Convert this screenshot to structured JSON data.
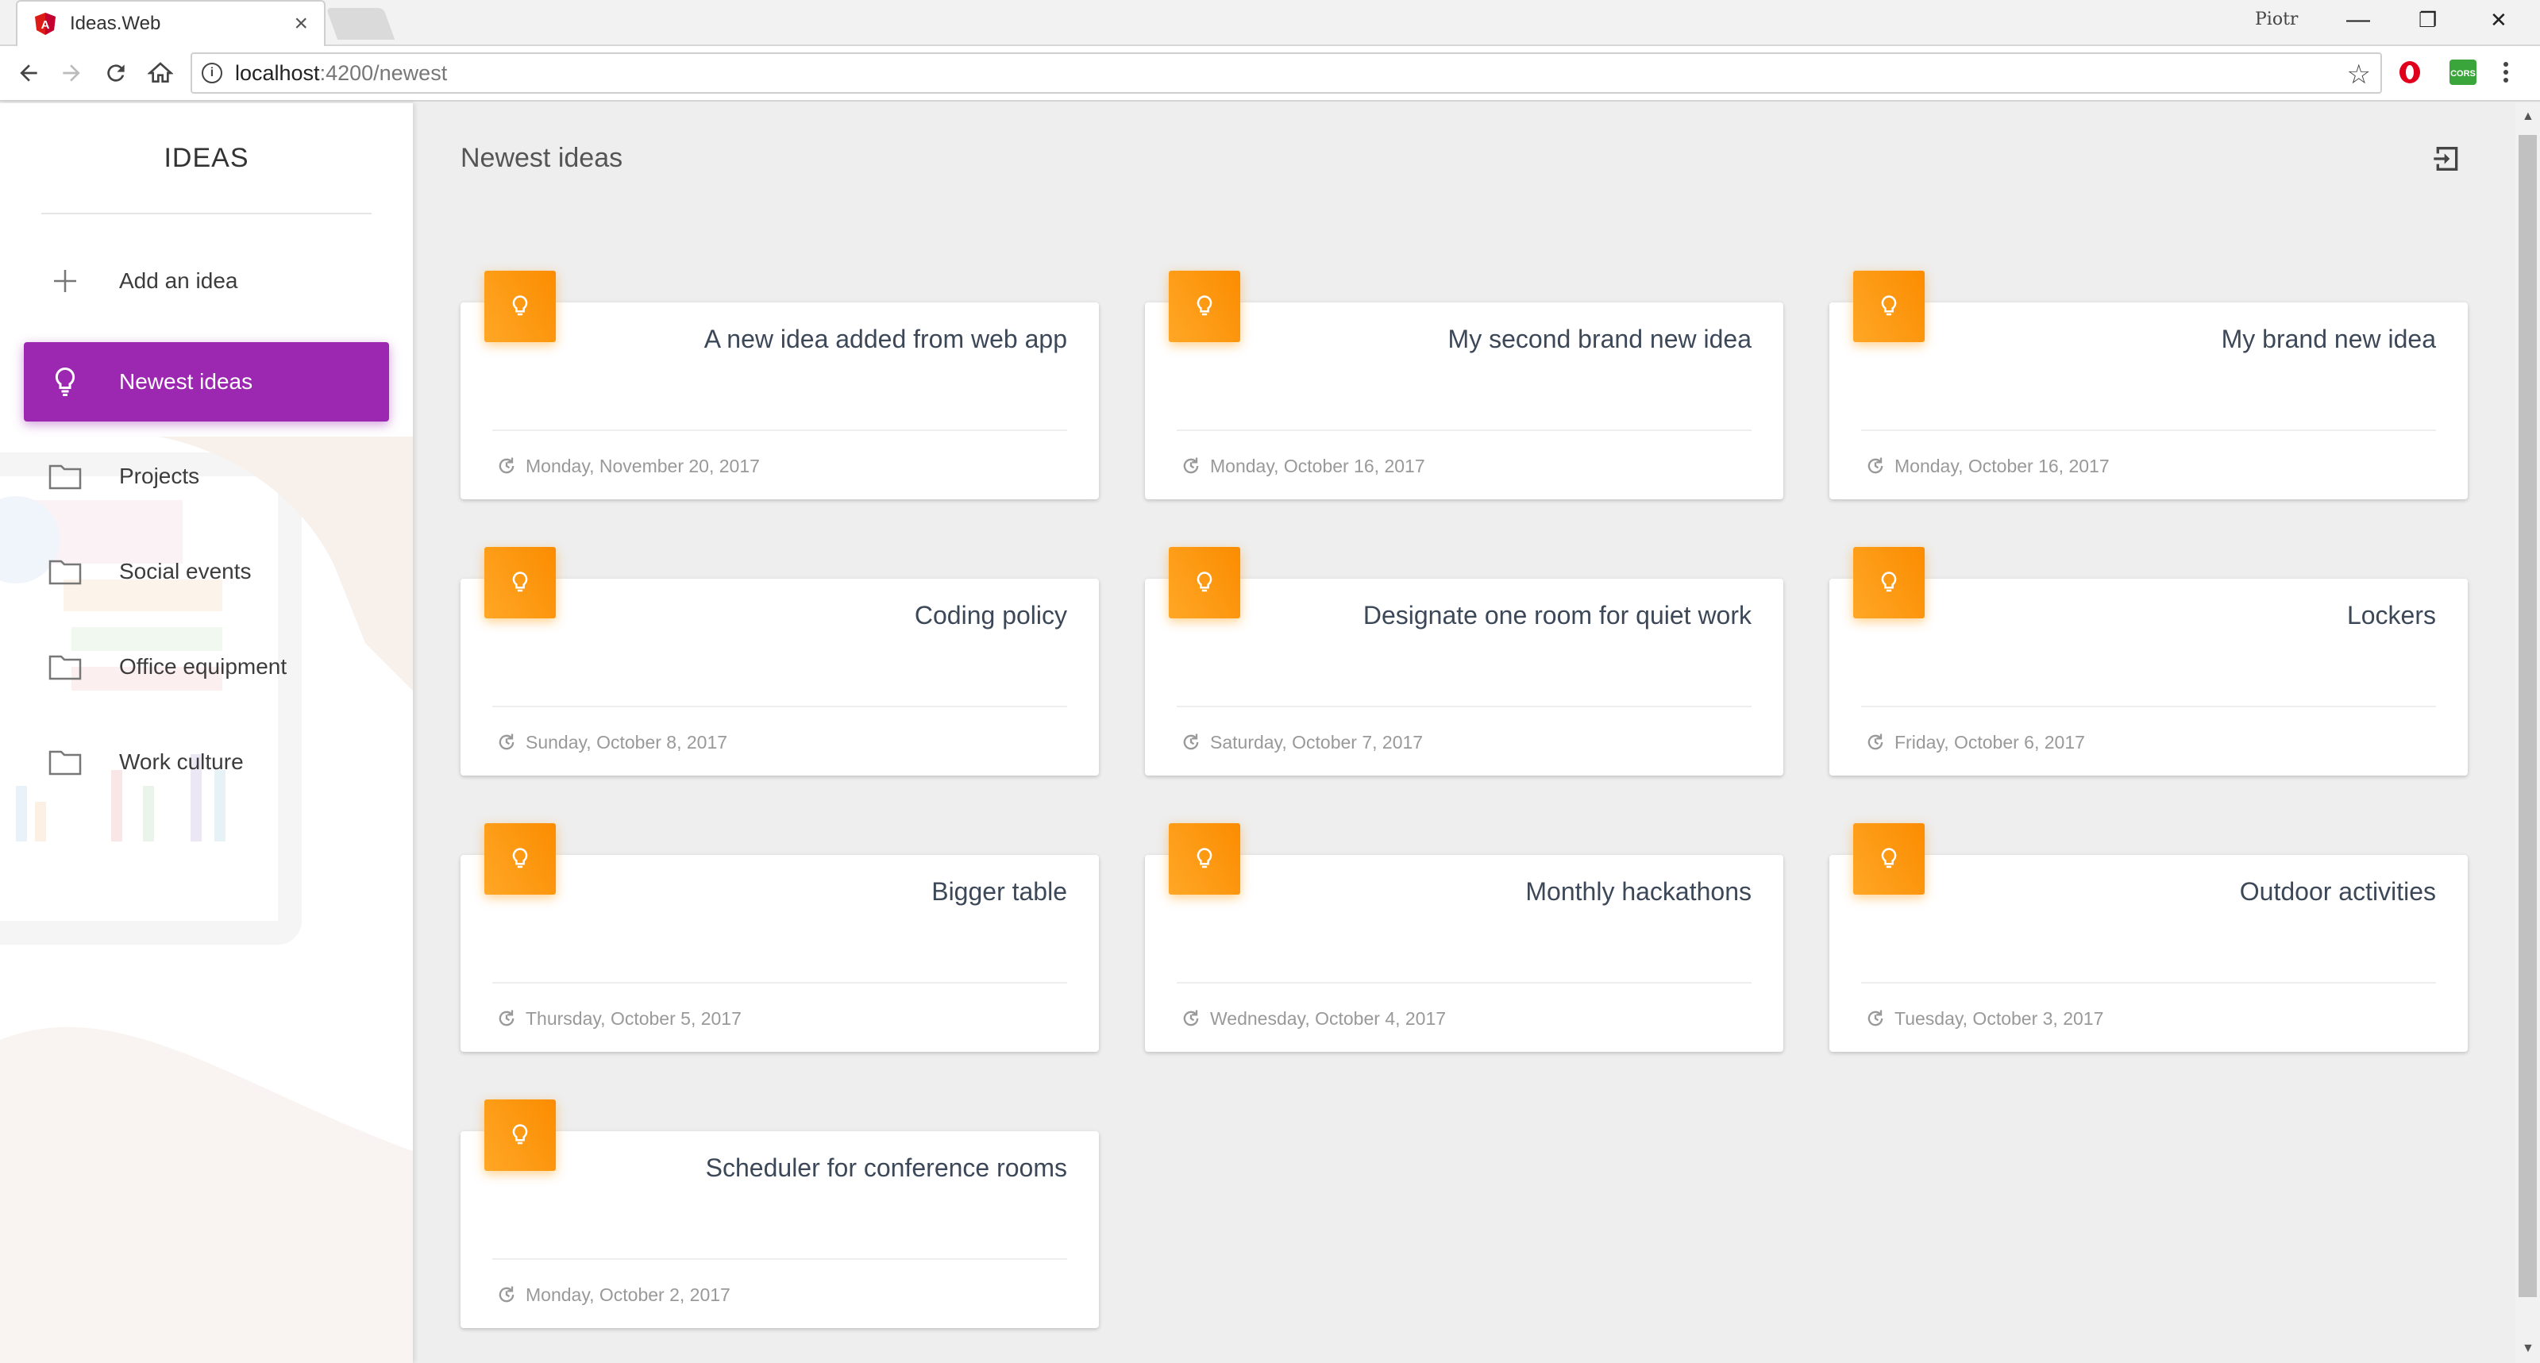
{
  "browser": {
    "tab_title": "Ideas.Web",
    "tab_close": "×",
    "profile_name": "Piotr",
    "url_host": "localhost",
    "url_path": ":4200/newest",
    "minimize": "—",
    "restore": "❐",
    "close": "✕",
    "info_icon_text": "i",
    "star_icon": "☆"
  },
  "sidebar": {
    "brand": "IDEAS",
    "items": [
      {
        "label": "Add an idea",
        "icon": "plus-icon",
        "active": false
      },
      {
        "label": "Newest ideas",
        "icon": "lightbulb-icon",
        "active": true
      },
      {
        "label": "Projects",
        "icon": "folder-icon",
        "active": false
      },
      {
        "label": "Social events",
        "icon": "folder-icon",
        "active": false
      },
      {
        "label": "Office equipment",
        "icon": "folder-icon",
        "active": false
      },
      {
        "label": "Work culture",
        "icon": "folder-icon",
        "active": false
      }
    ]
  },
  "main": {
    "title": "Newest ideas",
    "ideas": [
      {
        "title": "A new idea added from web app",
        "date": "Monday, November 20, 2017"
      },
      {
        "title": "My second brand new idea",
        "date": "Monday, October 16, 2017"
      },
      {
        "title": "My brand new idea",
        "date": "Monday, October 16, 2017"
      },
      {
        "title": "Coding policy",
        "date": "Sunday, October 8, 2017"
      },
      {
        "title": "Designate one room for quiet work",
        "date": "Saturday, October 7, 2017"
      },
      {
        "title": "Lockers",
        "date": "Friday, October 6, 2017"
      },
      {
        "title": "Bigger table",
        "date": "Thursday, October 5, 2017"
      },
      {
        "title": "Monthly hackathons",
        "date": "Wednesday, October 4, 2017"
      },
      {
        "title": "Outdoor activities",
        "date": "Tuesday, October 3, 2017"
      },
      {
        "title": "Scheduler for conference rooms",
        "date": "Monday, October 2, 2017"
      }
    ]
  },
  "colors": {
    "active_nav": "#9c27b0",
    "badge_start": "#ffa726",
    "badge_end": "#fb8c00",
    "page_bg": "#eeeeee",
    "date_text": "#999999"
  }
}
